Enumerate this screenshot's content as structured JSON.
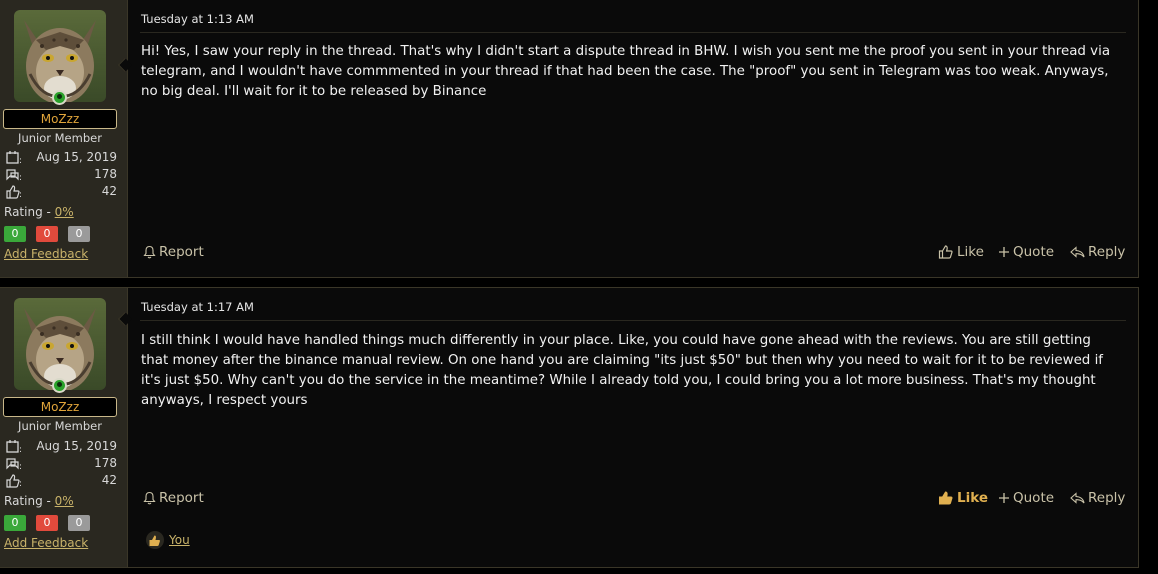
{
  "posts": [
    {
      "user": {
        "name": "MoZzz",
        "rank": "Junior Member",
        "joined": "Aug 15, 2019",
        "messages": "178",
        "reactions": "42",
        "rating_label": "Rating - ",
        "rating_value": "0%",
        "fb_pos": "0",
        "fb_neg": "0",
        "fb_neutral": "0",
        "add_feedback": "Add Feedback"
      },
      "date": "Tuesday at 1:13 AM",
      "body": "Hi! Yes, I saw your reply in the thread. That's why I didn't start a dispute thread in BHW. I wish you sent me the proof you sent in your thread via telegram, and I wouldn't have commmented in your thread if that had been the case. The \"proof\" you sent in Telegram was too weak. Anyways, no big deal. I'll wait for it to be released by Binance",
      "actions": {
        "report": "Report",
        "like": "Like",
        "quote": "Quote",
        "reply": "Reply"
      }
    },
    {
      "user": {
        "name": "MoZzz",
        "rank": "Junior Member",
        "joined": "Aug 15, 2019",
        "messages": "178",
        "reactions": "42",
        "rating_label": "Rating - ",
        "rating_value": "0%",
        "fb_pos": "0",
        "fb_neg": "0",
        "fb_neutral": "0",
        "add_feedback": "Add Feedback"
      },
      "date": "Tuesday at 1:17 AM",
      "body": "I still think I would have handled things much differently in your place. Like, you could have gone ahead with the reviews. You are still getting that money after the binance manual review. On one hand you are claiming \"its just $50\" but then why you need to wait for it to be reviewed if it's just $50. Why can't you do the service in the meantime? While I already told you, I could bring you a lot more business. That's my thought anyways, I respect yours",
      "actions": {
        "report": "Report",
        "like": "Like",
        "quote": "Quote",
        "reply": "Reply"
      },
      "reaction_by": "You"
    }
  ],
  "colors": {
    "accent": "#e0a43a",
    "link": "#c9b36a",
    "panel": "#2a2820",
    "liked": "#e0b050"
  },
  "icons": [
    "calendar-icon",
    "messages-icon",
    "thumbs-up-icon",
    "bell-icon",
    "plus-icon",
    "reply-icon",
    "online-icon"
  ]
}
